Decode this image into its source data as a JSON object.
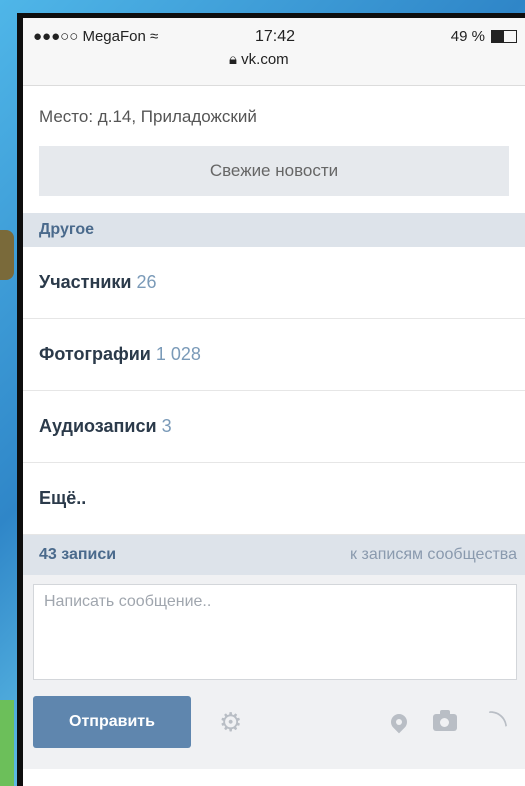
{
  "status_bar": {
    "carrier": "●●●○○ MegaFon",
    "wifi_icon": "wifi-icon",
    "time": "17:42",
    "url": "vk.com",
    "battery_text": "49 %",
    "battery_level": 0.49
  },
  "place": "Место: д.14, Приладожский",
  "news_button": "Свежие новости",
  "section_other": "Другое",
  "rows": [
    {
      "label": "Участники",
      "count": "26"
    },
    {
      "label": "Фотографии",
      "count": "1 028"
    },
    {
      "label": "Аудиозаписи",
      "count": "3"
    },
    {
      "label": "Ещё..",
      "count": ""
    }
  ],
  "posts": {
    "count_label": "43 записи",
    "link_label": "к записям сообщества"
  },
  "compose": {
    "placeholder": "Написать сообщение..",
    "send_label": "Отправить",
    "icons": [
      "gear-icon",
      "location-pin-icon",
      "camera-icon",
      "paperclip-icon"
    ]
  },
  "colors": {
    "accent": "#5f86ae",
    "section_bg": "#dde3ea",
    "count_text": "#7a9ab8"
  }
}
